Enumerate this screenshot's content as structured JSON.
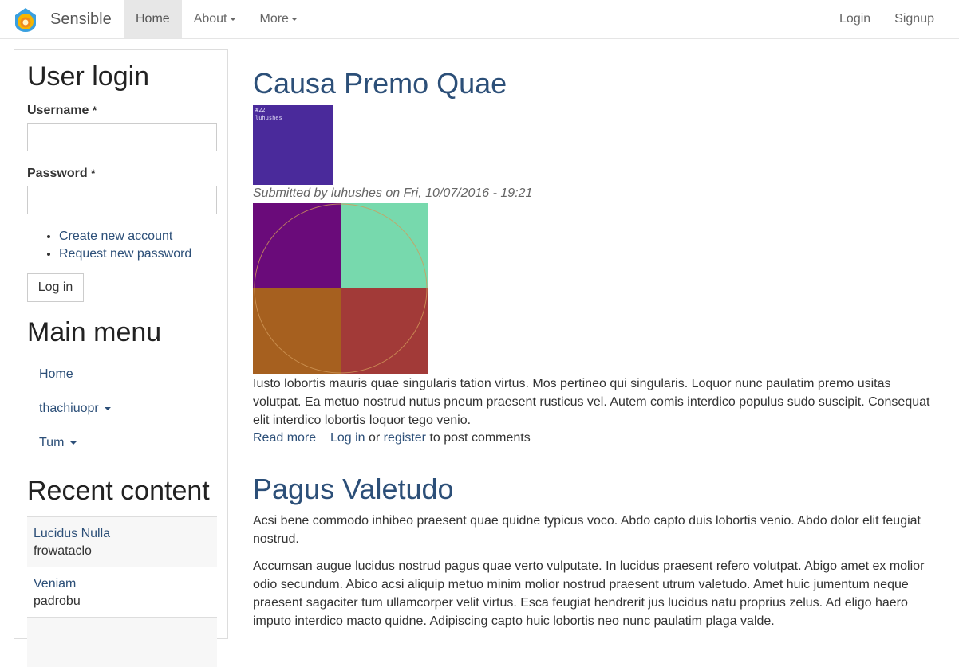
{
  "navbar": {
    "brand": "Sensible",
    "left_items": [
      {
        "label": "Home",
        "active": true,
        "dropdown": false
      },
      {
        "label": "About",
        "active": false,
        "dropdown": true
      },
      {
        "label": "More",
        "active": false,
        "dropdown": true
      }
    ],
    "right_items": [
      {
        "label": "Login"
      },
      {
        "label": "Signup"
      }
    ]
  },
  "sidebar": {
    "login": {
      "title": "User login",
      "username_label": "Username",
      "password_label": "Password",
      "required_mark": "*",
      "username_value": "",
      "password_value": "",
      "links": [
        "Create new account",
        "Request new password"
      ],
      "button": "Log in"
    },
    "menu": {
      "title": "Main menu",
      "items": [
        {
          "label": "Home",
          "dropdown": false
        },
        {
          "label": "thachiuopr",
          "dropdown": true
        },
        {
          "label": "Tum",
          "dropdown": true
        }
      ]
    },
    "recent": {
      "title": "Recent content",
      "items": [
        {
          "title": "Lucidus Nulla",
          "user": "frowataclo"
        },
        {
          "title": "Veniam",
          "user": "padrobu"
        }
      ]
    }
  },
  "articles": [
    {
      "title": "Causa Premo Quae",
      "avatar_text_1": "#22",
      "avatar_text_2": "luhushes",
      "submitted_prefix": "Submitted by ",
      "author": "luhushes",
      "submitted_on": " on Fri, 10/07/2016 - 19:21",
      "image_colors": [
        "#6a0b7a",
        "#77d9ad",
        "#a6601f",
        "#a23a38"
      ],
      "body": "Iusto lobortis mauris quae singularis tation virtus. Mos pertineo qui singularis. Loquor nunc paulatim premo usitas volutpat. Ea metuo nostrud nutus pneum praesent rusticus vel. Autem comis interdico populus sudo suscipit. Consequat elit interdico lobortis loquor tego venio.",
      "read_more": "Read more",
      "log_in": "Log in",
      "or": " or ",
      "register": "register",
      "post_comments": " to post comments"
    },
    {
      "title": "Pagus Valetudo",
      "paragraphs": [
        "Acsi bene commodo inhibeo praesent quae quidne typicus voco. Abdo capto duis lobortis venio. Abdo dolor elit feugiat nostrud.",
        "Accumsan augue lucidus nostrud pagus quae verto vulputate. In lucidus praesent refero volutpat. Abigo amet ex molior odio secundum. Abico acsi aliquip metuo minim molior nostrud praesent utrum valetudo. Amet huic jumentum neque praesent sagaciter tum ullamcorper velit virtus. Esca feugiat hendrerit jus lucidus natu proprius zelus. Ad eligo haero imputo interdico macto quidne. Adipiscing capto huic lobortis neo nunc paulatim plaga valde."
      ]
    }
  ]
}
